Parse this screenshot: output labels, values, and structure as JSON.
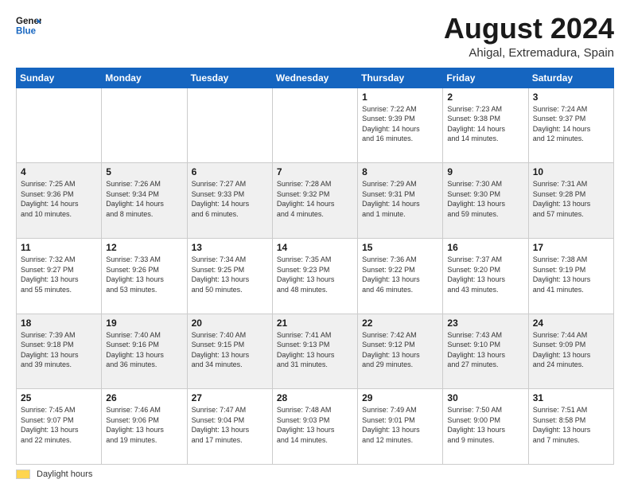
{
  "header": {
    "logo_line1": "General",
    "logo_line2": "Blue",
    "title": "August 2024",
    "subtitle": "Ahigal, Extremadura, Spain"
  },
  "footer": {
    "daylight_label": "Daylight hours"
  },
  "weekdays": [
    "Sunday",
    "Monday",
    "Tuesday",
    "Wednesday",
    "Thursday",
    "Friday",
    "Saturday"
  ],
  "weeks": [
    [
      {
        "day": "",
        "info": ""
      },
      {
        "day": "",
        "info": ""
      },
      {
        "day": "",
        "info": ""
      },
      {
        "day": "",
        "info": ""
      },
      {
        "day": "1",
        "info": "Sunrise: 7:22 AM\nSunset: 9:39 PM\nDaylight: 14 hours\nand 16 minutes."
      },
      {
        "day": "2",
        "info": "Sunrise: 7:23 AM\nSunset: 9:38 PM\nDaylight: 14 hours\nand 14 minutes."
      },
      {
        "day": "3",
        "info": "Sunrise: 7:24 AM\nSunset: 9:37 PM\nDaylight: 14 hours\nand 12 minutes."
      }
    ],
    [
      {
        "day": "4",
        "info": "Sunrise: 7:25 AM\nSunset: 9:36 PM\nDaylight: 14 hours\nand 10 minutes."
      },
      {
        "day": "5",
        "info": "Sunrise: 7:26 AM\nSunset: 9:34 PM\nDaylight: 14 hours\nand 8 minutes."
      },
      {
        "day": "6",
        "info": "Sunrise: 7:27 AM\nSunset: 9:33 PM\nDaylight: 14 hours\nand 6 minutes."
      },
      {
        "day": "7",
        "info": "Sunrise: 7:28 AM\nSunset: 9:32 PM\nDaylight: 14 hours\nand 4 minutes."
      },
      {
        "day": "8",
        "info": "Sunrise: 7:29 AM\nSunset: 9:31 PM\nDaylight: 14 hours\nand 1 minute."
      },
      {
        "day": "9",
        "info": "Sunrise: 7:30 AM\nSunset: 9:30 PM\nDaylight: 13 hours\nand 59 minutes."
      },
      {
        "day": "10",
        "info": "Sunrise: 7:31 AM\nSunset: 9:28 PM\nDaylight: 13 hours\nand 57 minutes."
      }
    ],
    [
      {
        "day": "11",
        "info": "Sunrise: 7:32 AM\nSunset: 9:27 PM\nDaylight: 13 hours\nand 55 minutes."
      },
      {
        "day": "12",
        "info": "Sunrise: 7:33 AM\nSunset: 9:26 PM\nDaylight: 13 hours\nand 53 minutes."
      },
      {
        "day": "13",
        "info": "Sunrise: 7:34 AM\nSunset: 9:25 PM\nDaylight: 13 hours\nand 50 minutes."
      },
      {
        "day": "14",
        "info": "Sunrise: 7:35 AM\nSunset: 9:23 PM\nDaylight: 13 hours\nand 48 minutes."
      },
      {
        "day": "15",
        "info": "Sunrise: 7:36 AM\nSunset: 9:22 PM\nDaylight: 13 hours\nand 46 minutes."
      },
      {
        "day": "16",
        "info": "Sunrise: 7:37 AM\nSunset: 9:20 PM\nDaylight: 13 hours\nand 43 minutes."
      },
      {
        "day": "17",
        "info": "Sunrise: 7:38 AM\nSunset: 9:19 PM\nDaylight: 13 hours\nand 41 minutes."
      }
    ],
    [
      {
        "day": "18",
        "info": "Sunrise: 7:39 AM\nSunset: 9:18 PM\nDaylight: 13 hours\nand 39 minutes."
      },
      {
        "day": "19",
        "info": "Sunrise: 7:40 AM\nSunset: 9:16 PM\nDaylight: 13 hours\nand 36 minutes."
      },
      {
        "day": "20",
        "info": "Sunrise: 7:40 AM\nSunset: 9:15 PM\nDaylight: 13 hours\nand 34 minutes."
      },
      {
        "day": "21",
        "info": "Sunrise: 7:41 AM\nSunset: 9:13 PM\nDaylight: 13 hours\nand 31 minutes."
      },
      {
        "day": "22",
        "info": "Sunrise: 7:42 AM\nSunset: 9:12 PM\nDaylight: 13 hours\nand 29 minutes."
      },
      {
        "day": "23",
        "info": "Sunrise: 7:43 AM\nSunset: 9:10 PM\nDaylight: 13 hours\nand 27 minutes."
      },
      {
        "day": "24",
        "info": "Sunrise: 7:44 AM\nSunset: 9:09 PM\nDaylight: 13 hours\nand 24 minutes."
      }
    ],
    [
      {
        "day": "25",
        "info": "Sunrise: 7:45 AM\nSunset: 9:07 PM\nDaylight: 13 hours\nand 22 minutes."
      },
      {
        "day": "26",
        "info": "Sunrise: 7:46 AM\nSunset: 9:06 PM\nDaylight: 13 hours\nand 19 minutes."
      },
      {
        "day": "27",
        "info": "Sunrise: 7:47 AM\nSunset: 9:04 PM\nDaylight: 13 hours\nand 17 minutes."
      },
      {
        "day": "28",
        "info": "Sunrise: 7:48 AM\nSunset: 9:03 PM\nDaylight: 13 hours\nand 14 minutes."
      },
      {
        "day": "29",
        "info": "Sunrise: 7:49 AM\nSunset: 9:01 PM\nDaylight: 13 hours\nand 12 minutes."
      },
      {
        "day": "30",
        "info": "Sunrise: 7:50 AM\nSunset: 9:00 PM\nDaylight: 13 hours\nand 9 minutes."
      },
      {
        "day": "31",
        "info": "Sunrise: 7:51 AM\nSunset: 8:58 PM\nDaylight: 13 hours\nand 7 minutes."
      }
    ]
  ]
}
